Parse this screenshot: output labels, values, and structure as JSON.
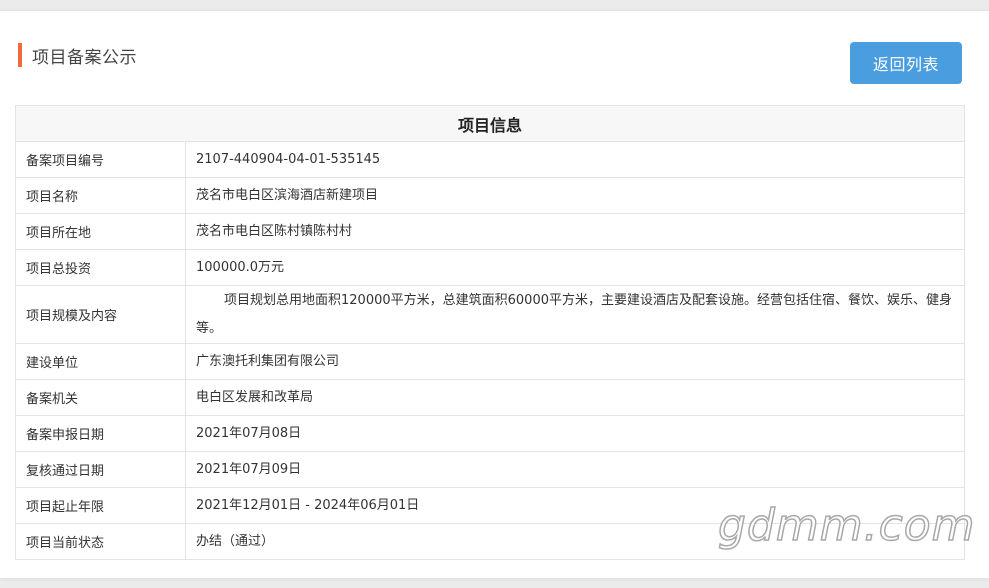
{
  "header": {
    "title": "项目备案公示",
    "accent_color": "#f06a3f",
    "back_button_label": "返回列表",
    "back_button_color": "#4a9ee0"
  },
  "table": {
    "caption": "项目信息",
    "rows": [
      {
        "label": "备案项目编号",
        "value": "2107-440904-04-01-535145"
      },
      {
        "label": "项目名称",
        "value": "茂名市电白区滨海酒店新建项目"
      },
      {
        "label": "项目所在地",
        "value": "茂名市电白区陈村镇陈村村"
      },
      {
        "label": "项目总投资",
        "value": "100000.0万元"
      },
      {
        "label": "项目规模及内容",
        "value": "项目规划总用地面积120000平方米，总建筑面积60000平方米，主要建设酒店及配套设施。经营包括住宿、餐饮、娱乐、健身等。"
      },
      {
        "label": "建设单位",
        "value": "广东澳托利集团有限公司"
      },
      {
        "label": "备案机关",
        "value": "电白区发展和改革局"
      },
      {
        "label": "备案申报日期",
        "value": "2021年07月08日"
      },
      {
        "label": "复核通过日期",
        "value": "2021年07月09日"
      },
      {
        "label": "项目起止年限",
        "value": "2021年12月01日 - 2024年06月01日"
      },
      {
        "label": "项目当前状态",
        "value": "办结（通过）"
      }
    ]
  },
  "watermark": {
    "text": "gdmm.com"
  }
}
